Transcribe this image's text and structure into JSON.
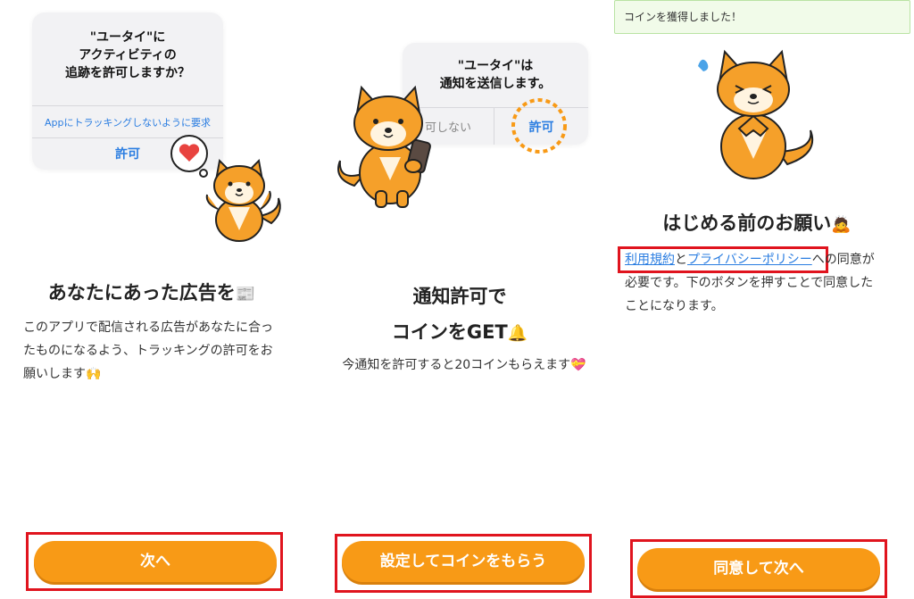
{
  "panel1": {
    "dialog": {
      "title_l1": "\"ユータイ\"に",
      "title_l2": "アクティビティの",
      "title_l3": "追跡を許可しますか？",
      "deny": "Appにトラッキングしないように要求",
      "allow": "許可"
    },
    "heading": "あなたにあった広告を",
    "heading_emoji": "📰",
    "body_l1": "このアプリで配信される広告があなたに合っ",
    "body_l2": "たものになるよう、トラッキングの許可をお",
    "body_l3": "願いします",
    "body_emoji": "🙌",
    "button": "次へ"
  },
  "panel2": {
    "dialog": {
      "title_l1": "\"ユータイ\"は",
      "title_l2": "通知を送信します。",
      "deny": "可しない",
      "allow": "許可"
    },
    "heading_l1": "通知許可で",
    "heading_l2": "コインをGET",
    "heading_emoji": "🔔",
    "body": "今通知を許可すると20コインもらえます",
    "body_emoji": "💝",
    "button": "設定してコインをもらう"
  },
  "panel3": {
    "toast": "コインを獲得しました！",
    "heading": "はじめる前のお願い",
    "heading_emoji": "🙇",
    "terms_link": "利用規約",
    "and": "と",
    "privacy_link": "プライバシーポリシー",
    "body_rest_l1": "への同意が",
    "body_l2": "必要です。下のボタンを押すことで同意した",
    "body_l3": "ことになります。",
    "button": "同意して次へ"
  },
  "colors": {
    "accent": "#f89a16",
    "highlight_box": "#e0141e",
    "link": "#2a7de1",
    "shiba": "#f5a02a"
  }
}
